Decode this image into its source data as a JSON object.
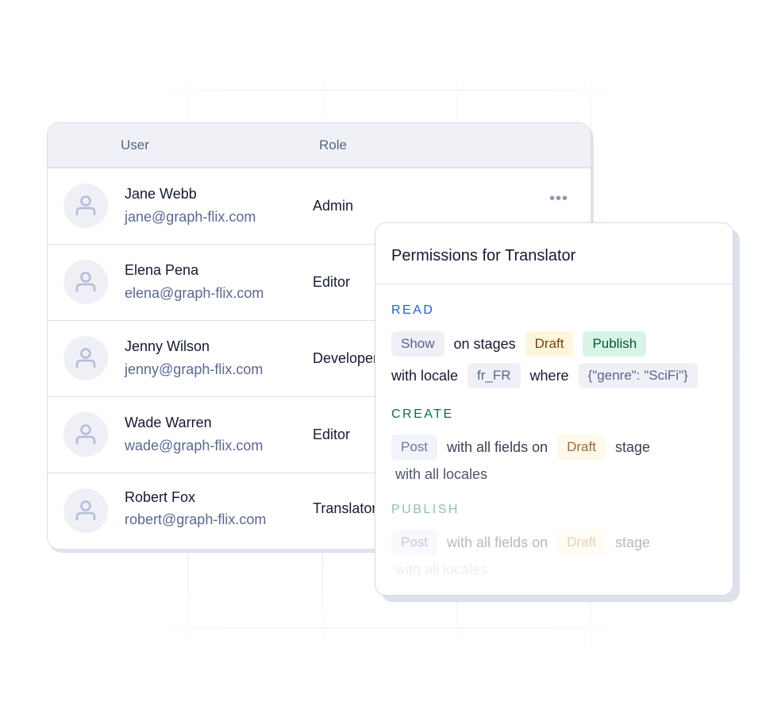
{
  "table": {
    "headers": {
      "user": "User",
      "role": "Role"
    },
    "rows": [
      {
        "name": "Jane Webb",
        "email": "jane@graph-flix.com",
        "role": "Admin",
        "menu": "•••"
      },
      {
        "name": "Elena Pena",
        "email": "elena@graph-flix.com",
        "role": "Editor"
      },
      {
        "name": "Jenny Wilson",
        "email": "jenny@graph-flix.com",
        "role": "Developer"
      },
      {
        "name": "Wade Warren",
        "email": "wade@graph-flix.com",
        "role": "Editor"
      },
      {
        "name": "Robert Fox",
        "email": "robert@graph-flix.com",
        "role": "Translator"
      }
    ]
  },
  "permissions": {
    "title": "Permissions for Translator",
    "read": {
      "label": "READ",
      "action": "Show",
      "on_stages": "on stages",
      "stage1": "Draft",
      "stage2": "Publish",
      "with_locale": "with locale",
      "locale": "fr_FR",
      "where": "where",
      "condition": "{\"genre\": \"SciFi\"}"
    },
    "create": {
      "label": "CREATE",
      "model": "Post",
      "fields_text": "with all fields on",
      "stage": "Draft",
      "stage_word": "stage",
      "locales_text": "with all locales"
    },
    "publish": {
      "label": "PUBLISH",
      "model": "Post",
      "fields_text": "with all fields on",
      "stage": "Draft",
      "stage_word": "stage",
      "locales_text": "with all locales"
    }
  },
  "colors": {
    "read": "#1d5fe0",
    "create": "#166a45",
    "publish": "#7fbf9e"
  }
}
